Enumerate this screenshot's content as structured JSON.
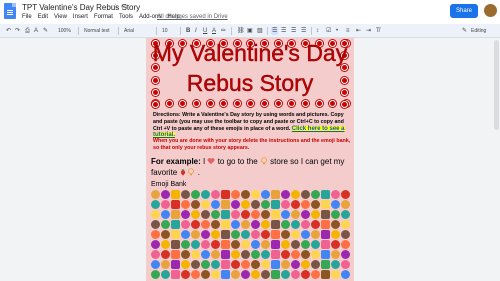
{
  "app": {
    "doc_title": "TPT Valentine's Day Rebus Story",
    "menu": [
      "File",
      "Edit",
      "View",
      "Insert",
      "Format",
      "Tools",
      "Add-ons",
      "Help"
    ],
    "save_status": "All changes saved in Drive",
    "share_label": "Share"
  },
  "toolbar": {
    "zoom": "100%",
    "style": "Normal text",
    "font": "Arial",
    "size": "10",
    "mode": "Editing"
  },
  "document": {
    "title_line1": "My Valentine's Day",
    "title_line2": "Rebus Story",
    "directions": "Directions:  Write a Valentine's Day story by using words and pictures. Copy and paste (you may use the toolbar to copy and paste or Ctrl+C to copy and Ctrl +V to paste any of these emojis in place of a word.",
    "tutorial_link": "Click here to see a  tutorial.",
    "note": "When you are done with your story delete the instructions and the emoji bank, so that only your rebus story appears.",
    "example_label": "For example:",
    "example_t1": " I ",
    "example_t2": " to go to the ",
    "example_t3": " store so I can get my favorite ",
    "example_t4": " .",
    "emoji_bank_label": "Emoji Bank"
  },
  "colors": {
    "page_bg": "#f4cccc",
    "title_red": "#c00000",
    "heart_red": "#cc0000",
    "link_highlight": "#ffff00",
    "share_blue": "#1a73e8"
  },
  "emoji_palette": [
    "#e8a33c",
    "#d93025",
    "#f4b400",
    "#8d5524",
    "#34a853",
    "#4285f4",
    "#f06292",
    "#9c27b0",
    "#ff7043",
    "#795548",
    "#ffd54f",
    "#26a69a"
  ]
}
